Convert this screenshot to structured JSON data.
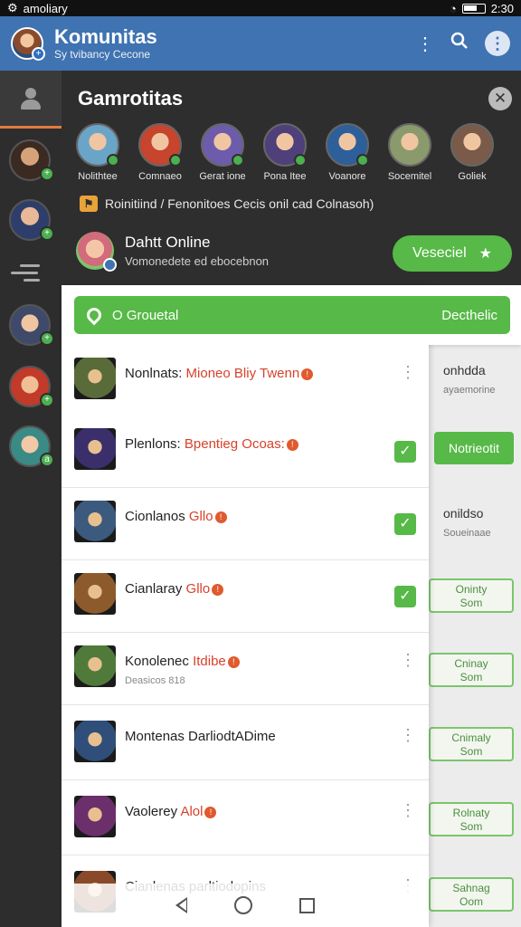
{
  "status_bar": {
    "carrier": "amoliary",
    "time": "2:30",
    "icons": [
      "settings-icon",
      "wifi-icon",
      "battery-icon"
    ]
  },
  "app_bar": {
    "title": "Komunitas",
    "subtitle": "Sy tvibancy Cecone",
    "actions": [
      "more-vert-icon",
      "search-icon",
      "info-icon"
    ]
  },
  "panel": {
    "title": "Gamrotitas",
    "friends": [
      {
        "name": "Nolithtee",
        "color": "#6aa5c8"
      },
      {
        "name": "Comnaeo",
        "color": "#c7442d"
      },
      {
        "name": "Gerat ione",
        "color": "#6d5cab"
      },
      {
        "name": "Pona Itee",
        "color": "#4f3f7a"
      },
      {
        "name": "Voanore",
        "color": "#2d5f9a"
      },
      {
        "name": "Socemitel",
        "color": "#8a9a6c"
      },
      {
        "name": "Goliek",
        "color": "#7a5a48"
      }
    ],
    "notice": "Roinitiind / Fenonitoes Cecis onil cad Colnasoh)",
    "online": {
      "title": "Dahtt Online",
      "subtitle": "Vomonedete ed ebocebnon"
    },
    "accept_label": "Veseciel"
  },
  "search": {
    "placeholder": "O Grouetal",
    "right_label": "Decthelic"
  },
  "list": [
    {
      "prefix": "Nonlnats:",
      "accent": "Mioneo Bliy",
      "accent2": "Twenn",
      "sub": "",
      "action": "more",
      "color": "#5a6b3a"
    },
    {
      "prefix": "Plenlons:",
      "accent": "Bpentieg Ocoas:",
      "accent2": "",
      "sub": "",
      "action": "check",
      "color": "#3a2f6b"
    },
    {
      "prefix": "Cionlanos",
      "accent": "Gllo",
      "accent2": "",
      "sub": "",
      "action": "check",
      "color": "#3c5a7d"
    },
    {
      "prefix": "Cianlaray",
      "accent": "Gllo",
      "accent2": "",
      "sub": "",
      "action": "check",
      "color": "#8c5a2b"
    },
    {
      "prefix": "Konolenec",
      "accent": "Itdibe",
      "accent2": "",
      "sub": "Deasicos 818",
      "action": "more",
      "color": "#4f7a3a"
    },
    {
      "prefix": "Montenas",
      "accent": "",
      "accent2": "",
      "plain": "DarliodtADime",
      "sub": "",
      "action": "more",
      "color": "#2f4f7a"
    },
    {
      "prefix": "Vaolerey",
      "accent": "Alol",
      "accent2": "",
      "sub": "",
      "action": "more",
      "color": "#6b2f6b"
    },
    {
      "prefix": "Cianlenas",
      "accent": "",
      "accent2": "",
      "plain": "parltiodopins",
      "sub": "",
      "action": "more",
      "color": "#8a4a2a"
    }
  ],
  "right_col": {
    "row1_title": "onhdda",
    "row1_sub": "ayaemorine",
    "btn_label": "Notrieotit",
    "row3_title": "onildso",
    "row3_sub": "Soueinaae",
    "outline_buttons": [
      {
        "line1": "Oninty",
        "line2": "Som"
      },
      {
        "line1": "Cninay",
        "line2": "Som"
      },
      {
        "line1": "Cnimaly",
        "line2": "Som"
      },
      {
        "line1": "Rolnaty",
        "line2": "Som"
      },
      {
        "line1": "Sahnag",
        "line2": "Oom"
      }
    ]
  },
  "navbar": {
    "icons": [
      "back-icon",
      "home-icon",
      "recents-icon"
    ]
  }
}
